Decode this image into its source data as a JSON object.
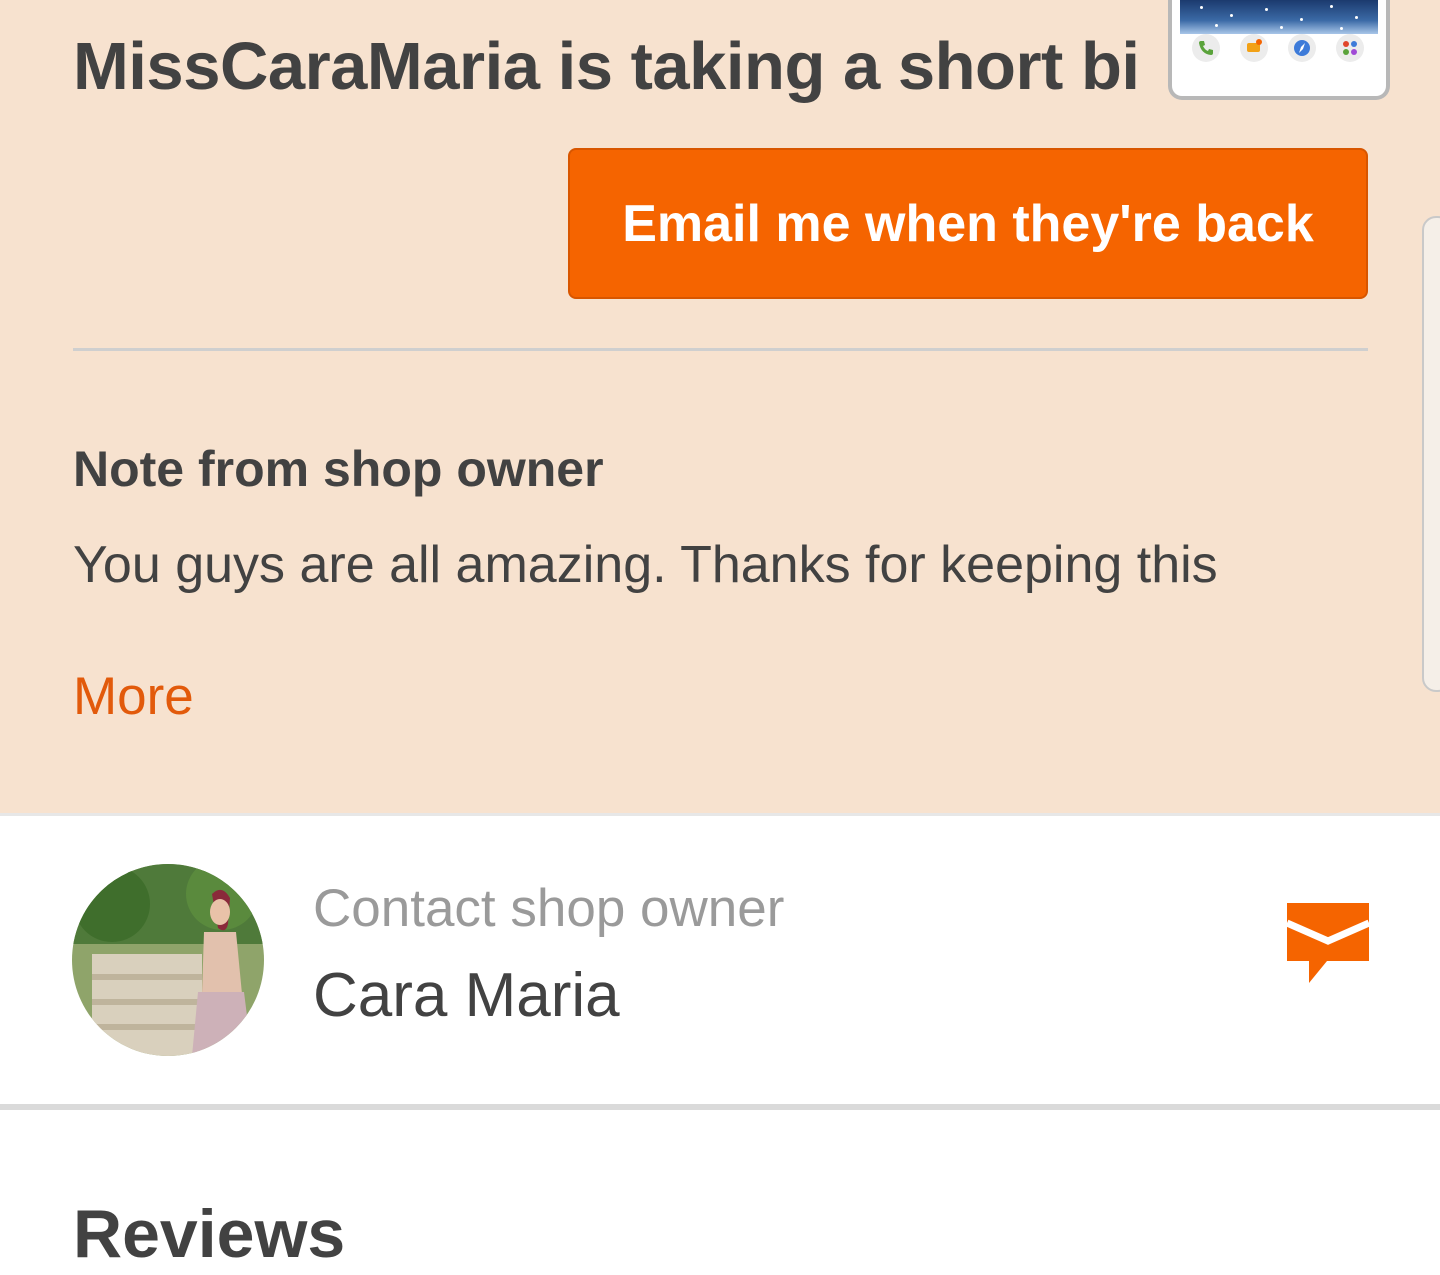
{
  "banner": {
    "headline": "MissCaraMaria is taking a short bi",
    "email_button_label": "Email me when they're back",
    "note_title": "Note from shop owner",
    "note_body": "You guys are all amazing. Thanks for keeping this",
    "more_link": "More"
  },
  "contact": {
    "label": "Contact shop owner",
    "name": "Cara Maria",
    "message_icon": "message-icon"
  },
  "reviews": {
    "heading": "Reviews"
  },
  "floating_window": {
    "icons": [
      "phone-icon",
      "chat-icon",
      "compass-icon",
      "apps-icon"
    ]
  },
  "colors": {
    "accent": "#f56400",
    "banner_bg": "#f7e2cf",
    "link": "#e25a0b",
    "text_dark": "#424242",
    "text_muted": "#9a9a9a"
  }
}
